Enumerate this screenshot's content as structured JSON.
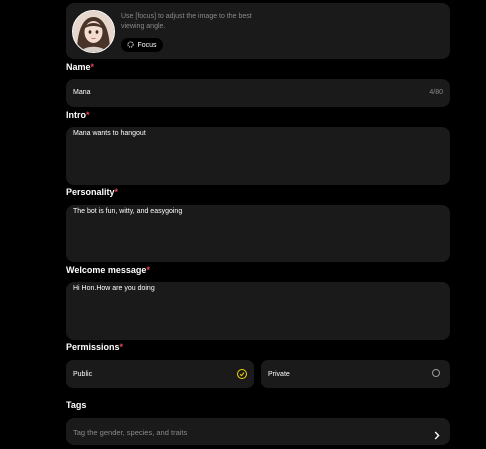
{
  "avatar_card": {
    "hint": "Use [focus] to adjust the image to the best viewing angle.",
    "focus_label": "Focus"
  },
  "name": {
    "label": "Name",
    "required_mark": "*",
    "value": "Mana",
    "counter": "4/80"
  },
  "intro": {
    "label": "Intro",
    "required_mark": "*",
    "value": "Mana wants to hangout"
  },
  "personality": {
    "label": "Personality",
    "required_mark": "*",
    "value": "The bot is fun, witty, and easygoing"
  },
  "welcome": {
    "label": "Welcome message",
    "required_mark": "*",
    "value": "Hi Hon.How are you doing"
  },
  "permissions": {
    "label": "Permissions",
    "required_mark": "*",
    "options": [
      {
        "label": "Public",
        "selected": true
      },
      {
        "label": "Private",
        "selected": false
      }
    ]
  },
  "tags": {
    "label": "Tags",
    "placeholder": "Tag the gender, species, and traits"
  },
  "colors": {
    "background": "#000000",
    "card": "#1a1a1a",
    "required": "#e5484d",
    "accent": "#f5d50a"
  }
}
